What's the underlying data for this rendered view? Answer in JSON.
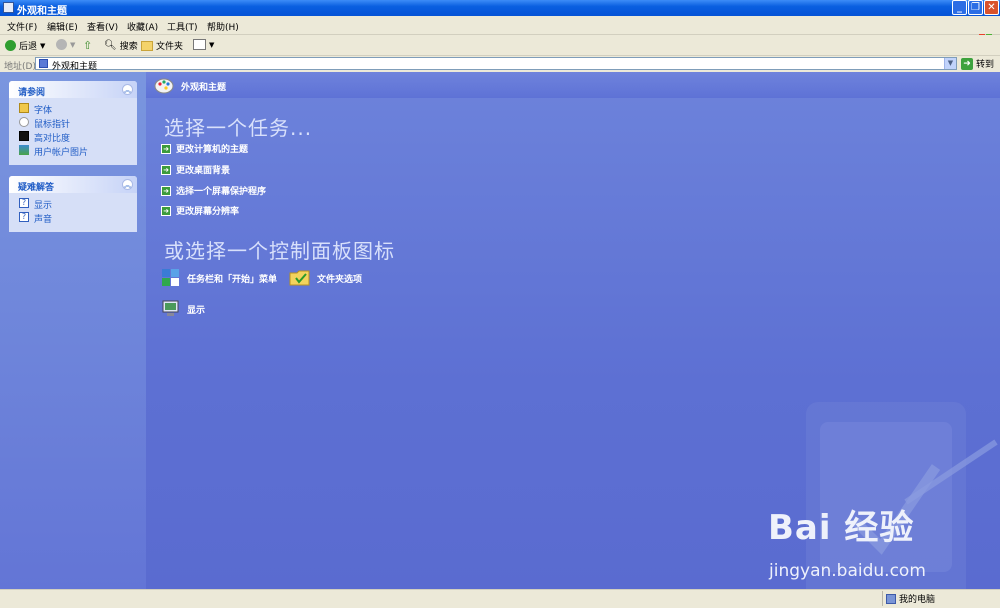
{
  "window": {
    "title": "外观和主题"
  },
  "menu": {
    "items": [
      "文件(F)",
      "编辑(E)",
      "查看(V)",
      "收藏(A)",
      "工具(T)",
      "帮助(H)"
    ]
  },
  "toolbar": {
    "back": "后退",
    "search": "搜索",
    "folders": "文件夹"
  },
  "address": {
    "label": "地址(D)",
    "value": "外观和主题",
    "go": "转到"
  },
  "sidebar": {
    "see_also": {
      "title": "请参阅",
      "items": [
        "字体",
        "鼠标指针",
        "高对比度",
        "用户帐户图片"
      ]
    },
    "troubleshoot": {
      "title": "疑难解答",
      "items": [
        "显示",
        "声音"
      ]
    }
  },
  "main": {
    "header": "外观和主题",
    "pick_task": "选择一个任务...",
    "tasks": [
      "更改计算机的主题",
      "更改桌面背景",
      "选择一个屏幕保护程序",
      "更改屏幕分辨率"
    ],
    "pick_icon": "或选择一个控制面板图标",
    "icons": [
      "任务栏和「开始」菜单",
      "文件夹选项",
      "显示"
    ]
  },
  "watermark": {
    "logo": "Bai 经验",
    "url": "jingyan.baidu.com"
  },
  "status": {
    "zone": "我的电脑"
  }
}
